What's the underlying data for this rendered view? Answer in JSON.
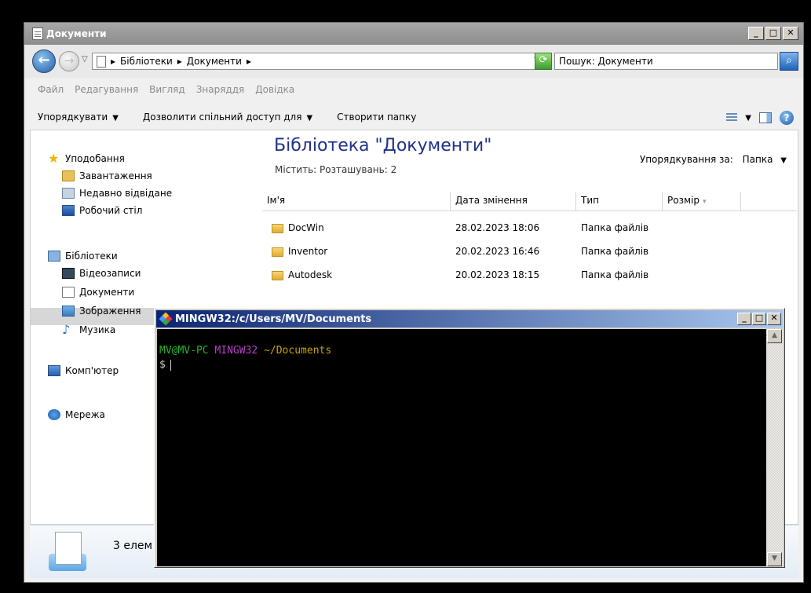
{
  "explorer": {
    "title": "Документи",
    "breadcrumbs": [
      "Бібліотеки",
      "Документи"
    ],
    "search_placeholder": "Пошук: Документи",
    "menu": [
      "Файл",
      "Редагування",
      "Вигляд",
      "Знаряддя",
      "Довідка"
    ],
    "commands": {
      "organize": "Упорядкувати",
      "share": "Дозволити спільний доступ для",
      "new_folder": "Створити папку"
    },
    "nav": {
      "favorites": "Уподобання",
      "downloads": "Завантаження",
      "recent": "Недавно відвідане",
      "desktop": "Робочий стіл",
      "libraries": "Бібліотеки",
      "videos": "Відеозаписи",
      "documents": "Документи",
      "pictures": "Зображення",
      "music": "Музика",
      "computer": "Комп'ютер",
      "network": "Мережа"
    },
    "library": {
      "title": "Бібліотека \"Документи\"",
      "subtitle": "Містить:  Розташувань: 2",
      "sort_label": "Упорядкування за:",
      "sort_value": "Папка"
    },
    "columns": {
      "name": "Ім'я",
      "date": "Дата змінення",
      "type": "Тип",
      "size": "Розмір"
    },
    "rows": [
      {
        "name": "DocWin",
        "date": "28.02.2023 18:06",
        "type": "Папка файлів"
      },
      {
        "name": "Inventor",
        "date": "20.02.2023 16:46",
        "type": "Папка файлів"
      },
      {
        "name": "Autodesk",
        "date": "20.02.2023 18:15",
        "type": "Папка файлів"
      }
    ],
    "status_count": "3 елем"
  },
  "terminal": {
    "title": "MINGW32:/c/Users/MV/Documents",
    "prompt_user": "MV@MV-PC",
    "prompt_system": "MINGW32",
    "prompt_dir": "~/Documents",
    "prompt_symbol": "$"
  },
  "colors": {
    "title_gray": "#8d8d8d",
    "library_title": "#1e3287",
    "terminal_bg": "#000000",
    "prompt_user": "#2ab52a",
    "prompt_system": "#b640c4",
    "prompt_dir": "#c8a500"
  }
}
